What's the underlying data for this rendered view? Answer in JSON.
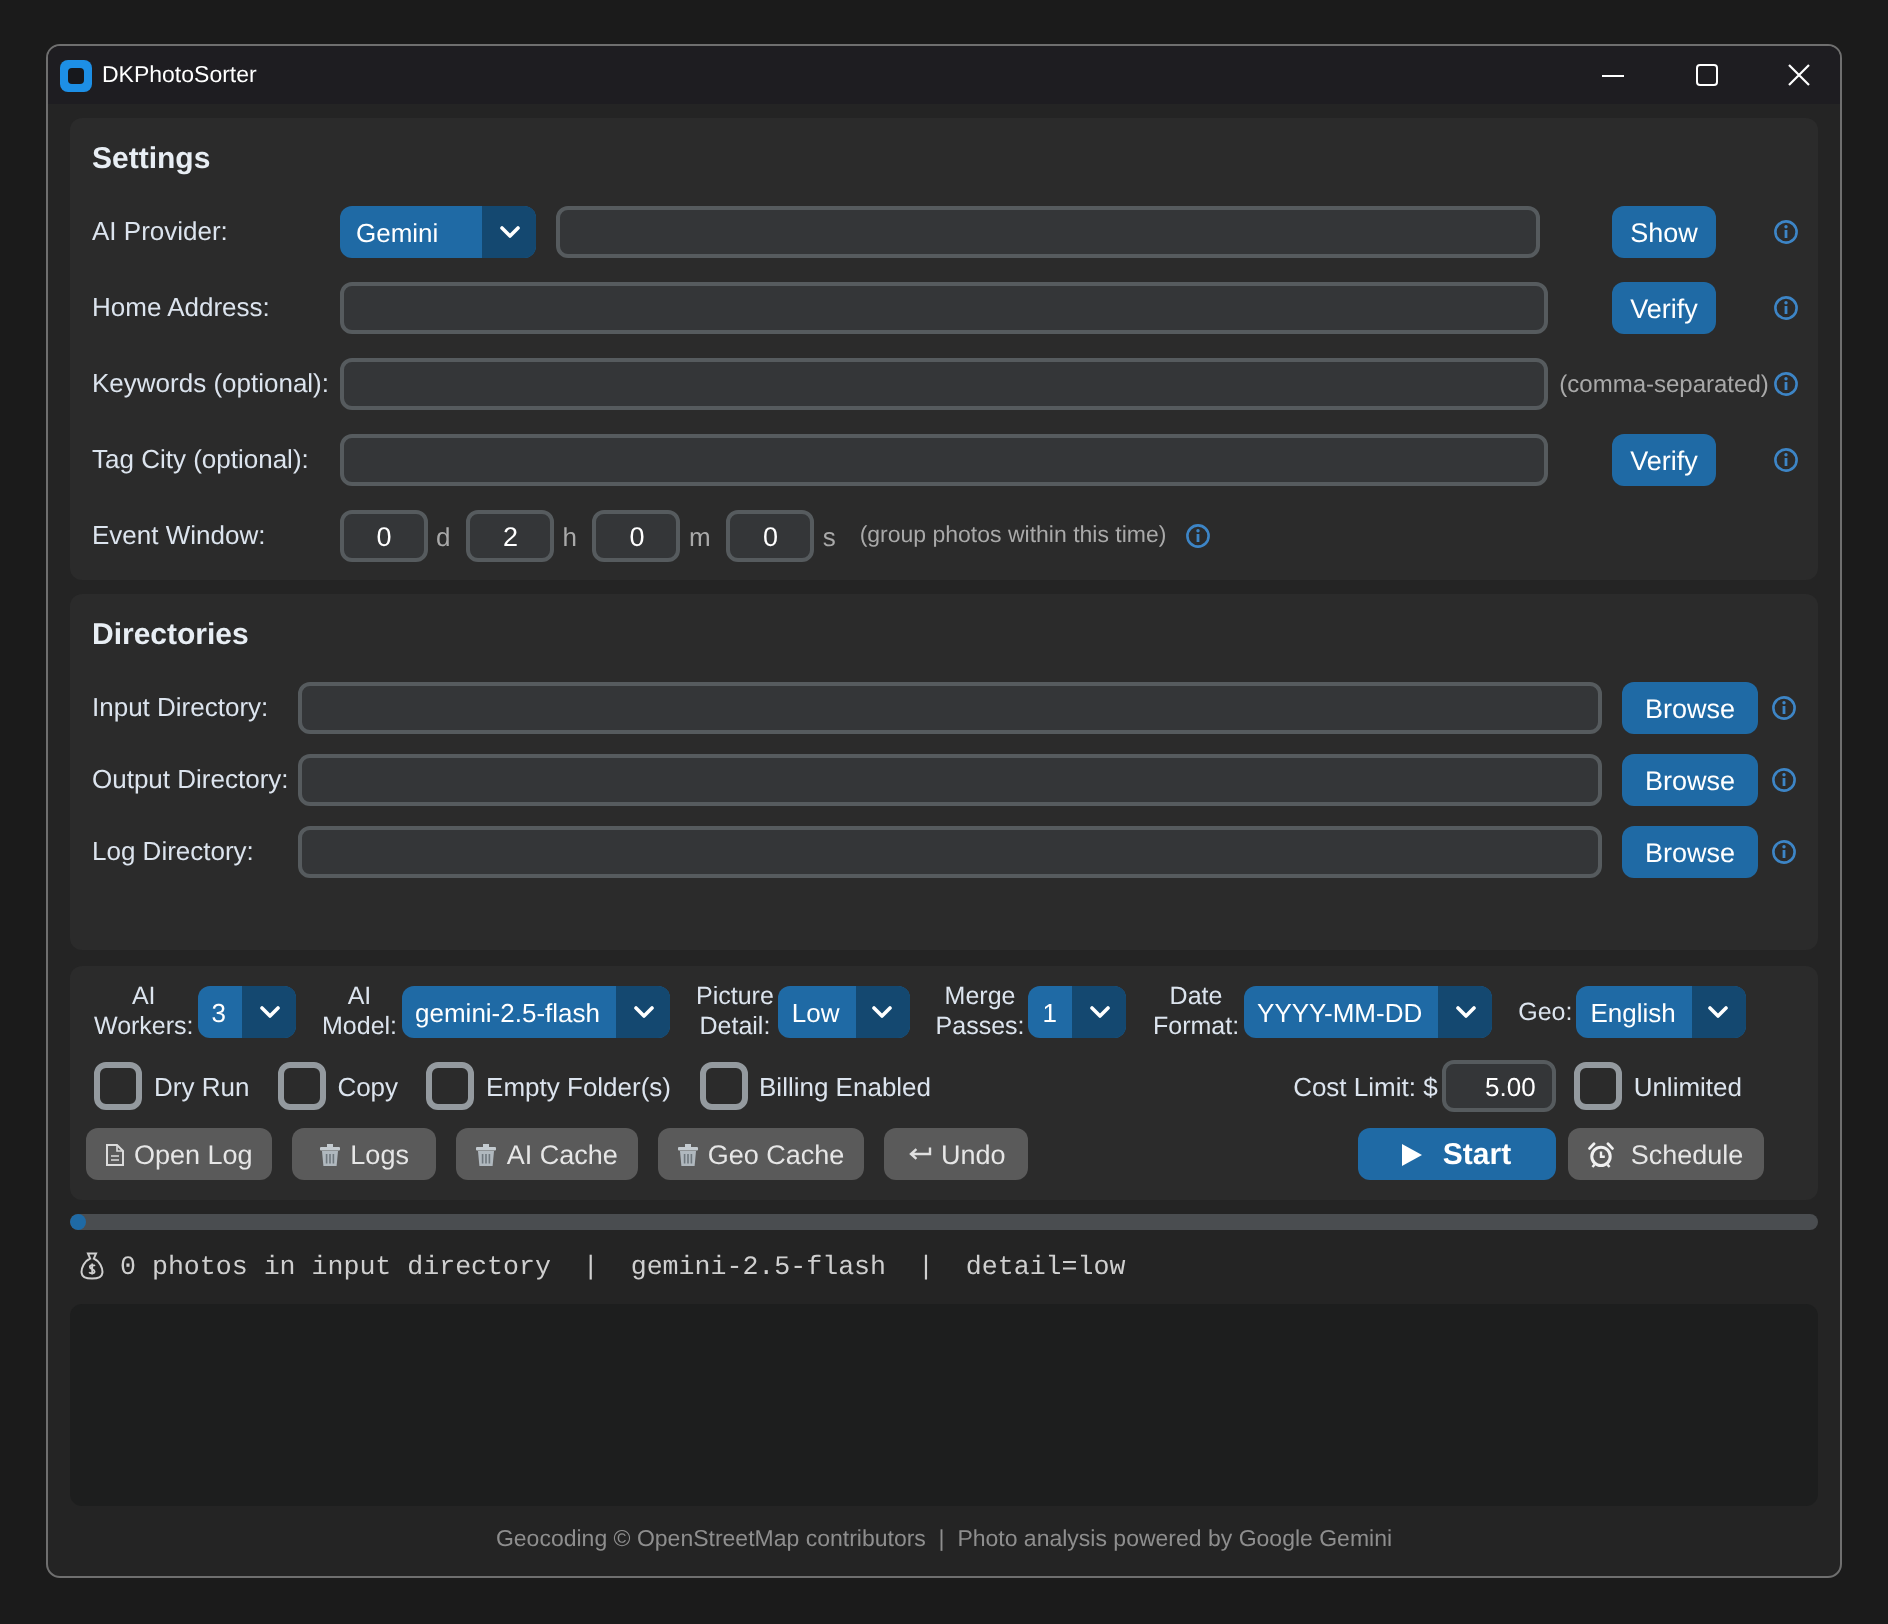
{
  "window": {
    "title": "DKPhotoSorter"
  },
  "settings": {
    "title": "Settings",
    "rows": [
      {
        "kind": "secret",
        "label": "AI Provider:",
        "dropdown": "Gemini",
        "button": "Show"
      },
      {
        "kind": "verify",
        "label": "Home Address:",
        "button": "Verify"
      },
      {
        "kind": "hint",
        "label": "Keywords (optional):",
        "hint": "(comma-separated)"
      },
      {
        "kind": "verify",
        "label": "Tag City (optional):",
        "button": "Verify"
      },
      {
        "kind": "duration",
        "label": "Event Window:",
        "fields": [
          {
            "value": "0",
            "unit": "d"
          },
          {
            "value": "2",
            "unit": "h"
          },
          {
            "value": "0",
            "unit": "m"
          },
          {
            "value": "0",
            "unit": "s"
          }
        ],
        "hint": "(group photos within this time)"
      }
    ]
  },
  "directories": {
    "title": "Directories",
    "rows": [
      {
        "label": "Input Directory:",
        "button": "Browse"
      },
      {
        "label": "Output Directory:",
        "button": "Browse"
      },
      {
        "label": "Log Directory:",
        "button": "Browse"
      }
    ]
  },
  "options": {
    "dropdowns": [
      {
        "label": "AI Workers:",
        "value": "3"
      },
      {
        "label": "AI Model:",
        "value": "gemini-2.5-flash"
      },
      {
        "label": "Picture Detail:",
        "value": "Low"
      },
      {
        "label": "Merge Passes:",
        "value": "1"
      },
      {
        "label": "Date Format:",
        "value": "YYYY-MM-DD"
      },
      {
        "label": "Geo:",
        "value": "English"
      }
    ],
    "checkboxes": [
      {
        "label": "Dry Run",
        "checked": false
      },
      {
        "label": "Copy",
        "checked": false
      },
      {
        "label": "Empty Folder(s)",
        "checked": false
      },
      {
        "label": "Billing Enabled",
        "checked": false
      }
    ],
    "cost_limit": {
      "label": "Cost Limit: $",
      "value": "5.00"
    },
    "unlimited": {
      "label": "Unlimited",
      "checked": false
    },
    "tools": [
      {
        "kind": "open",
        "label": "Open Log"
      },
      {
        "kind": "clear",
        "label": "Logs"
      },
      {
        "kind": "clear",
        "label": "AI Cache"
      },
      {
        "kind": "clear",
        "label": "Geo Cache"
      },
      {
        "kind": "undo",
        "label": "Undo"
      }
    ],
    "actions": [
      {
        "kind": "start",
        "label": "Start"
      },
      {
        "kind": "schedule",
        "label": "Schedule"
      }
    ]
  },
  "progress": {
    "level": 0
  },
  "status": "0 photos in input directory  |  gemini-2.5-flash  |  detail=low",
  "footer": "Geocoding © OpenStreetMap contributors  |  Photo analysis powered by Google Gemini"
}
